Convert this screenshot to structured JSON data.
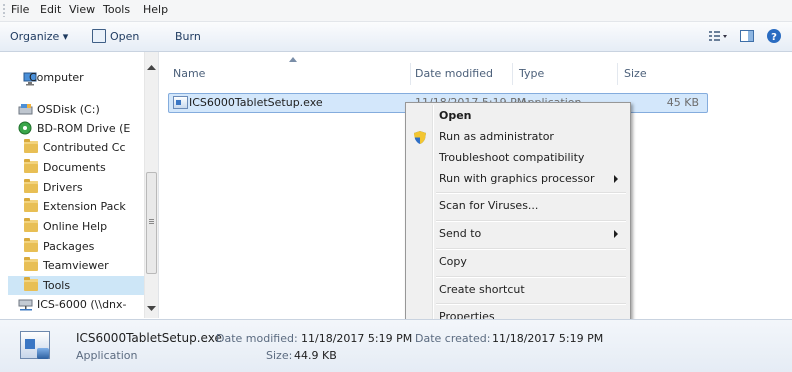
{
  "menubar": {
    "items": [
      "File",
      "Edit",
      "View",
      "Tools",
      "Help"
    ]
  },
  "toolbar": {
    "organize": "Organize ▾",
    "open": "Open",
    "burn": "Burn"
  },
  "nav": {
    "items": [
      {
        "label": "Computer",
        "icon": "computer-icon"
      },
      {
        "label": "OSDisk (C:)",
        "icon": "drive-icon"
      },
      {
        "label": "BD-ROM Drive (E",
        "icon": "disc-icon"
      },
      {
        "label": "Contributed Cc",
        "icon": "folder-icon"
      },
      {
        "label": "Documents",
        "icon": "folder-icon"
      },
      {
        "label": "Drivers",
        "icon": "folder-icon"
      },
      {
        "label": "Extension Pack",
        "icon": "folder-icon"
      },
      {
        "label": "Online Help",
        "icon": "folder-icon"
      },
      {
        "label": "Packages",
        "icon": "folder-icon"
      },
      {
        "label": "Teamviewer",
        "icon": "folder-icon"
      },
      {
        "label": "Tools",
        "icon": "folder-icon",
        "selected": true
      },
      {
        "label": "ICS-6000 (\\\\dnx-",
        "icon": "network-drive-icon"
      }
    ]
  },
  "columns": {
    "name": "Name",
    "date": "Date modified",
    "type": "Type",
    "size": "Size"
  },
  "file": {
    "name": "ICS6000TabletSetup.exe",
    "date": "11/18/2017 5:19 PM",
    "type": "Application",
    "size": "45 KB"
  },
  "context_menu": {
    "items": [
      {
        "label": "Open",
        "bold": true
      },
      {
        "label": "Run as administrator",
        "icon": "uac-shield-icon"
      },
      {
        "label": "Troubleshoot compatibility"
      },
      {
        "label": "Run with graphics processor",
        "submenu": true
      },
      {
        "label": "Scan for Viruses..."
      },
      {
        "label": "Send to",
        "submenu": true
      },
      {
        "label": "Copy"
      },
      {
        "label": "Create shortcut"
      },
      {
        "label": "Properties"
      }
    ]
  },
  "details": {
    "filename": "ICS6000TabletSetup.exe",
    "type": "Application",
    "date_modified_label": "Date modified:",
    "date_modified": "11/18/2017 5:19 PM",
    "size_label": "Size:",
    "size": "44.9 KB",
    "date_created_label": "Date created:",
    "date_created": "11/18/2017 5:19 PM"
  },
  "colors": {
    "selection": "#cde6f7",
    "toolbar_text": "#1e3a5f",
    "header_text": "#4c607a"
  }
}
